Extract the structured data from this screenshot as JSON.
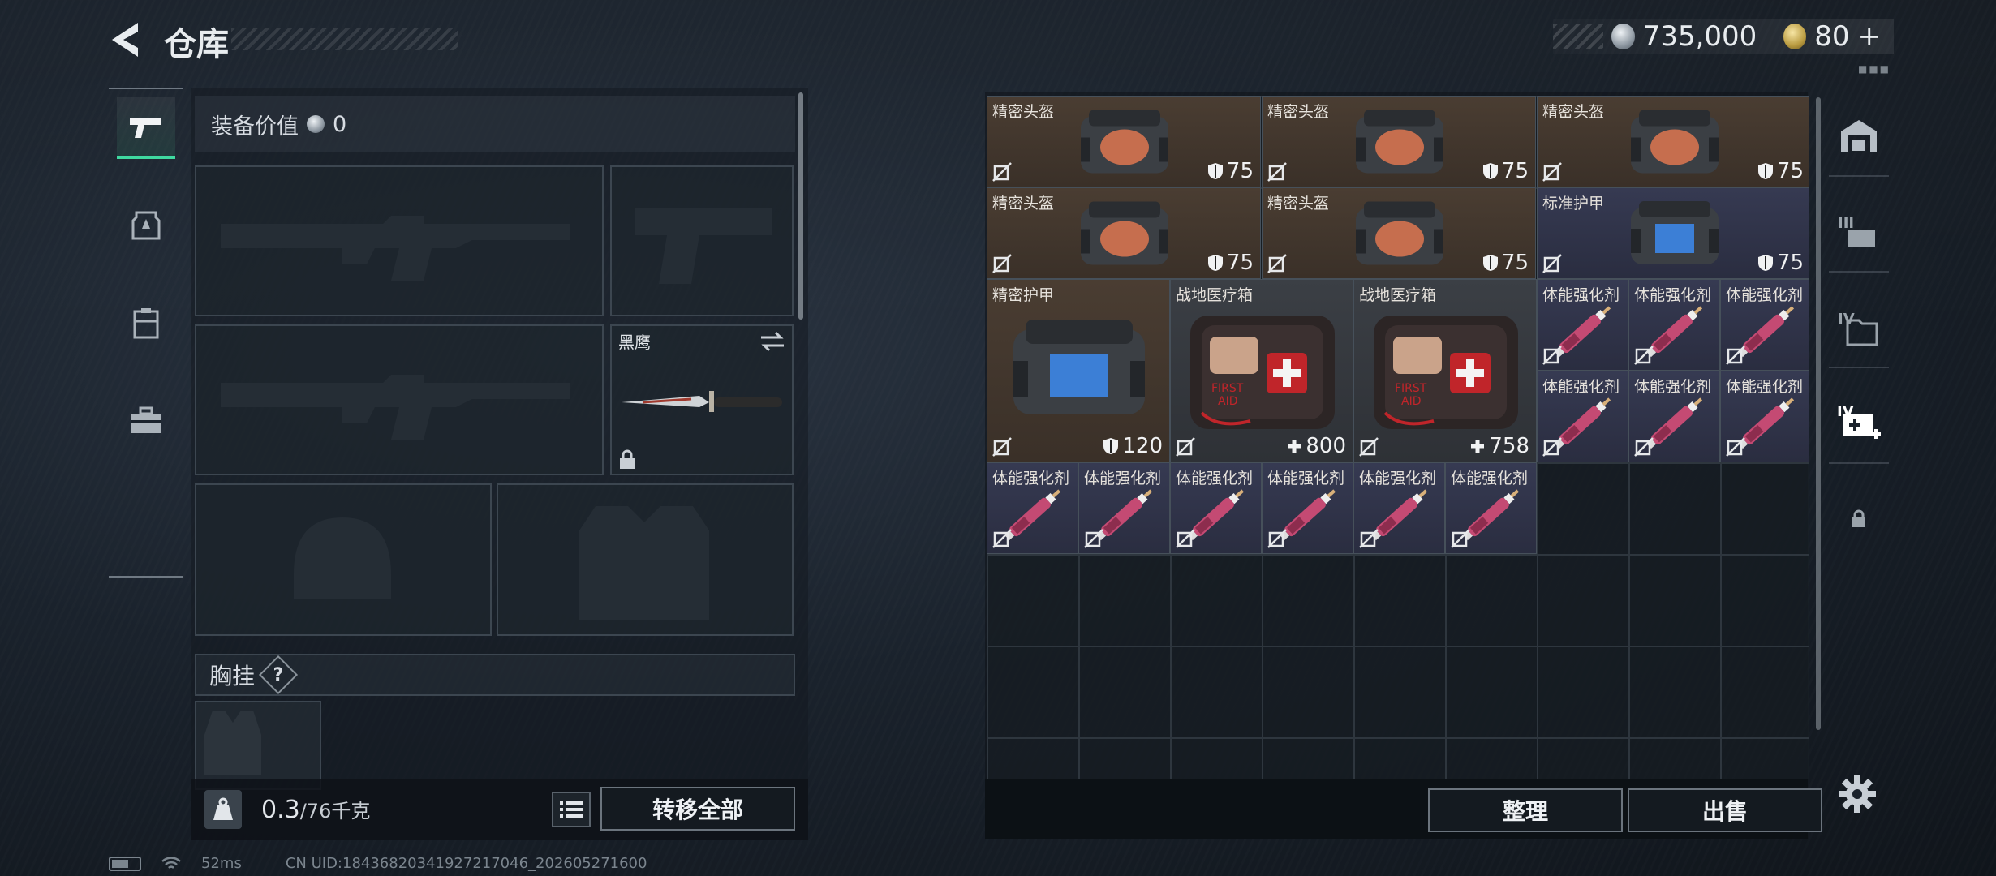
{
  "header": {
    "title": "仓库",
    "silver": "735,000",
    "gold": "80",
    "gold_plus": "+",
    "dots": "■■■"
  },
  "loadout": {
    "equip_value_label": "装备价值",
    "equip_value": "0",
    "knife_label": "黑鹰",
    "chest_label": "胸挂",
    "help": "?",
    "weight_value": "0.3",
    "weight_cap": "/76千克",
    "transfer_all": "转移全部"
  },
  "storage": {
    "items": [
      {
        "name": "精密头盔",
        "value": "75",
        "stat": "armor",
        "color": "brown",
        "pic": "helmet-red"
      },
      {
        "name": "精密头盔",
        "value": "75",
        "stat": "armor",
        "color": "brown",
        "pic": "helmet-red"
      },
      {
        "name": "精密头盔",
        "value": "75",
        "stat": "armor",
        "color": "brown",
        "pic": "helmet-red"
      },
      {
        "name": "精密头盔",
        "value": "75",
        "stat": "armor",
        "color": "brown",
        "pic": "helmet-red"
      },
      {
        "name": "精密头盔",
        "value": "75",
        "stat": "armor",
        "color": "brown",
        "pic": "helmet-red"
      },
      {
        "name": "标准护甲",
        "value": "75",
        "stat": "armor",
        "color": "blue",
        "pic": "vest-blue"
      },
      {
        "name": "精密护甲",
        "value": "120",
        "stat": "armor",
        "color": "brown",
        "pic": "vest-blue"
      },
      {
        "name": "战地医疗箱",
        "value": "800",
        "stat": "heal",
        "color": "gray",
        "pic": "medkit"
      },
      {
        "name": "战地医疗箱",
        "value": "758",
        "stat": "heal",
        "color": "gray",
        "pic": "medkit"
      },
      {
        "name": "体能强化剂",
        "color": "blue",
        "pic": "syringe"
      },
      {
        "name": "体能强化剂",
        "color": "blue",
        "pic": "syringe"
      },
      {
        "name": "体能强化剂",
        "color": "blue",
        "pic": "syringe"
      },
      {
        "name": "体能强化剂",
        "color": "blue",
        "pic": "syringe"
      },
      {
        "name": "体能强化剂",
        "color": "blue",
        "pic": "syringe"
      },
      {
        "name": "体能强化剂",
        "color": "blue",
        "pic": "syringe"
      },
      {
        "name": "体能强化剂",
        "color": "blue",
        "pic": "syringe"
      },
      {
        "name": "体能强化剂",
        "color": "blue",
        "pic": "syringe"
      },
      {
        "name": "体能强化剂",
        "color": "blue",
        "pic": "syringe"
      },
      {
        "name": "体能强化剂",
        "color": "blue",
        "pic": "syringe"
      },
      {
        "name": "体能强化剂",
        "color": "blue",
        "pic": "syringe"
      },
      {
        "name": "体能强化剂",
        "color": "blue",
        "pic": "syringe"
      }
    ],
    "sort_label": "整理",
    "sell_label": "出售"
  },
  "right_nav": [
    "garage-icon",
    "tier3-icon",
    "tier4-folder-icon",
    "tier4-medkit-icon",
    "lock-icon"
  ],
  "status": {
    "ping": "52ms",
    "uid": "CN UID:184368203419272170​46_202605271600"
  },
  "colors": {
    "accent_green": "#3fd9a0"
  }
}
